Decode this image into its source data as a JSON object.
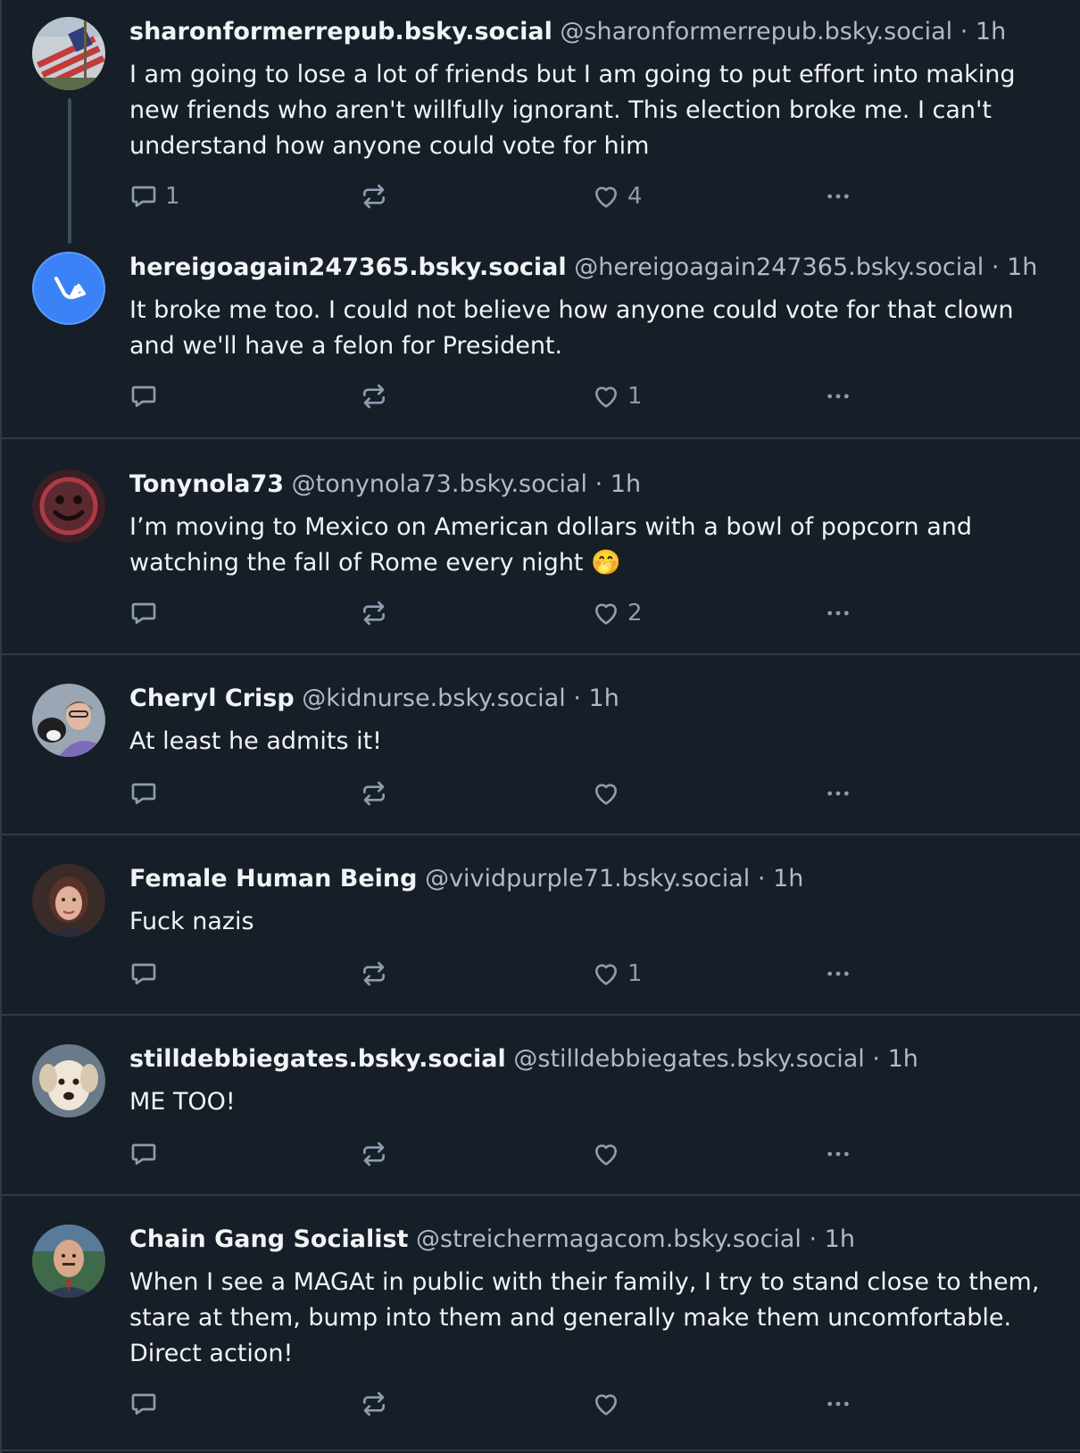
{
  "posts": [
    {
      "display_name": "sharonformerrepub.bsky.social",
      "handle": "@sharonformerrepub.bsky.social",
      "time": "1h",
      "text": "I am going to lose a lot of friends but I am going to put effort into making new friends who aren't willfully ignorant. This election broke me. I can't understand how anyone could vote for him",
      "replies": "1",
      "reposts": "",
      "likes": "4"
    },
    {
      "display_name": "hereigoagain247365.bsky.social",
      "handle": "@hereigoagain247365.bsky.social",
      "time": "1h",
      "text": "It broke me too. I could not believe how anyone could vote for that clown and we'll have a felon for President.",
      "replies": "",
      "reposts": "",
      "likes": "1"
    },
    {
      "display_name": "Tonynola73",
      "handle": "@tonynola73.bsky.social",
      "time": "1h",
      "text": "I’m moving to Mexico on American dollars with a bowl of popcorn and watching the fall of Rome every night 🤭",
      "replies": "",
      "reposts": "",
      "likes": "2"
    },
    {
      "display_name": "Cheryl Crisp",
      "handle": "@kidnurse.bsky.social",
      "time": "1h",
      "text": "At least he admits it!",
      "replies": "",
      "reposts": "",
      "likes": ""
    },
    {
      "display_name": "Female Human Being",
      "handle": "@vividpurple71.bsky.social",
      "time": "1h",
      "text": "Fuck nazis",
      "replies": "",
      "reposts": "",
      "likes": "1"
    },
    {
      "display_name": "stilldebbiegates.bsky.social",
      "handle": "@stilldebbiegates.bsky.social",
      "time": "1h",
      "text": "ME TOO!",
      "replies": "",
      "reposts": "",
      "likes": ""
    },
    {
      "display_name": "Chain Gang Socialist",
      "handle": "@streichermagacom.bsky.social",
      "time": "1h",
      "text": "When I see a MAGAt in public with their family, I try to stand close to them, stare at them, bump into them and generally make them uncomfortable. Direct action!",
      "replies": "",
      "reposts": "",
      "likes": ""
    }
  ],
  "separator": "·",
  "colors": {
    "background": "#161e27",
    "divider": "#2e3a47",
    "text": "#f1f3f5",
    "muted": "#aebbc9",
    "icon": "#8d9caf",
    "default_avatar": "#3b82f6"
  },
  "icons": {
    "reply": "reply-icon",
    "repost": "repost-icon",
    "like": "heart-icon",
    "more": "more-options-icon"
  }
}
